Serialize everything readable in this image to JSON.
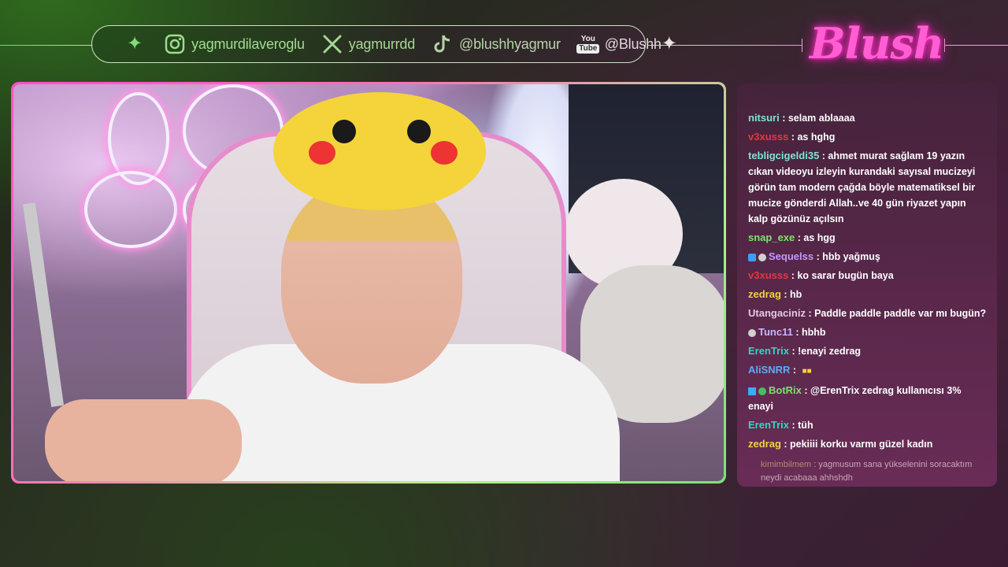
{
  "social_bar": {
    "instagram": "yagmurdilaveroglu",
    "x": "yagmurrdd",
    "tiktok": "@blushhyagmur",
    "youtube_badge_top": "You",
    "youtube_badge_bottom": "Tube",
    "youtube": "@Blushh"
  },
  "logo": {
    "text": "Blush"
  },
  "chat": {
    "messages": [
      {
        "user": "nitsuri",
        "color": "#7fe3d2",
        "text": "selam ablaaaa"
      },
      {
        "user": "v3xusss",
        "color": "#e3383f",
        "text": "as hghg"
      },
      {
        "user": "tebligcigeldi35",
        "color": "#7fe3d2",
        "text": "ahmet murat sağlam 19 yazın cıkan videoyu izleyin kurandaki sayısal mucizeyi görün tam modern çağda böyle matematiksel bir mucize gönderdi Allah..ve 40 gün riyazet yapın kalp gözünüz açılsın"
      },
      {
        "user": "snap_exe",
        "color": "#7ee26a",
        "text": "as hgg"
      },
      {
        "user": "Sequelss",
        "color": "#c39aff",
        "text": "hbb yağmuş"
      },
      {
        "user": "v3xusss",
        "color": "#e3383f",
        "text": "ko sarar bugün baya"
      },
      {
        "user": "zedrag",
        "color": "#f0d24a",
        "text": "hb"
      },
      {
        "user": "Utangaciniz",
        "color": "#e6c8de",
        "text": "Paddle paddle paddle var mı bugün?"
      },
      {
        "user": "Tunc11",
        "color": "#c6b7ff",
        "text": "hbhb"
      },
      {
        "user": "ErenTrix",
        "color": "#35d6c0",
        "text": "!enayi zedrag"
      },
      {
        "user": "AliSNRR",
        "color": "#5fa8ff",
        "text": ""
      },
      {
        "user": "BotRix",
        "color": "#7ee26a",
        "text": "@ErenTrix zedrag kullanıcısı 3% enayi"
      },
      {
        "user": "ErenTrix",
        "color": "#35d6c0",
        "text": "tüh"
      },
      {
        "user": "zedrag",
        "color": "#f0d24a",
        "text": "pekiiii korku varmı güzel kadın"
      },
      {
        "user": "kimimbilmem",
        "color": "#b88a6e",
        "text": "yagmusum sana yükselenini soracaktım neydi acabaaa ahhshdh"
      }
    ],
    "separator": " : "
  }
}
